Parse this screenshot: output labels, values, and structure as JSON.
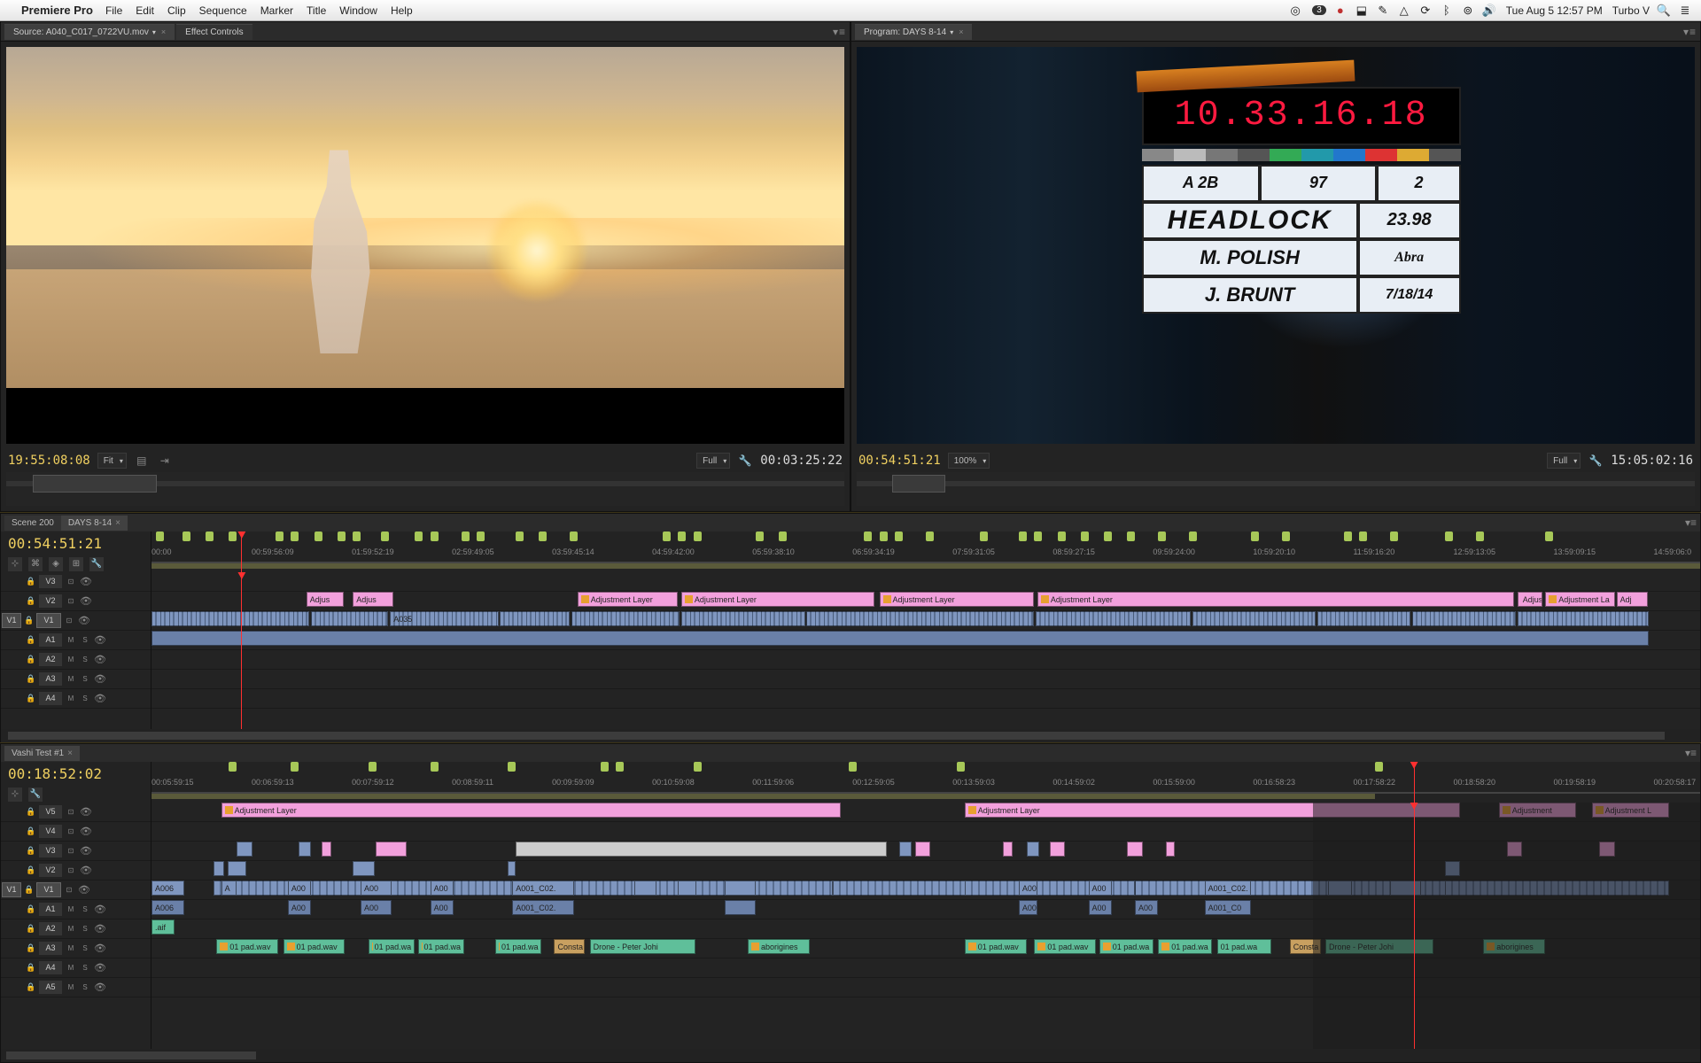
{
  "menubar": {
    "app": "Premiere Pro",
    "items": [
      "File",
      "Edit",
      "Clip",
      "Sequence",
      "Marker",
      "Title",
      "Window",
      "Help"
    ],
    "clock": "Tue Aug 5  12:57 PM",
    "user": "Turbo V",
    "badge": "3"
  },
  "source": {
    "tabs": [
      {
        "label": "Source: A040_C017_0722VU.mov",
        "active": true
      },
      {
        "label": "Effect Controls",
        "active": false
      }
    ],
    "tc_in": "19:55:08:08",
    "zoom": "Fit",
    "res": "Full",
    "duration": "00:03:25:22"
  },
  "program": {
    "tabs": [
      {
        "label": "Program: DAYS 8-14",
        "active": true
      }
    ],
    "tc": "00:54:51:21",
    "zoom": "100%",
    "res": "Full",
    "duration": "15:05:02:16",
    "slate": {
      "smpte": "10.33.16.18",
      "scene": "A 2B",
      "take": "97",
      "roll": "2",
      "title": "HEADLOCK",
      "fps": "23.98",
      "dp": "M. POLISH",
      "loc": "Abra",
      "ac": "J. BRUNT",
      "date": "7/18/14"
    }
  },
  "timeline1": {
    "tabs": [
      {
        "label": "Scene 200",
        "active": false
      },
      {
        "label": "DAYS 8-14",
        "active": true
      }
    ],
    "tc": "00:54:51:21",
    "ruler": [
      "00:00",
      "00:59:56:09",
      "01:59:52:19",
      "02:59:49:05",
      "03:59:45:14",
      "04:59:42:00",
      "05:59:38:10",
      "06:59:34:19",
      "07:59:31:05",
      "08:59:27:15",
      "09:59:24:00",
      "10:59:20:10",
      "11:59:16:20",
      "12:59:13:05",
      "13:59:09:15",
      "14:59:06:0"
    ],
    "tracks": [
      "V3",
      "V2",
      "V1",
      "A1",
      "A2",
      "A3",
      "A4"
    ],
    "adj_label": "Adjustment Layer",
    "adj_short": "Adjus",
    "a035": "A035"
  },
  "timeline2": {
    "tabs": [
      {
        "label": "Vashi Test #1",
        "active": true
      }
    ],
    "tc": "00:18:52:02",
    "ruler": [
      "00:05:59:15",
      "00:06:59:13",
      "00:07:59:12",
      "00:08:59:11",
      "00:09:59:09",
      "00:10:59:08",
      "00:11:59:06",
      "00:12:59:05",
      "00:13:59:03",
      "00:14:59:02",
      "00:15:59:00",
      "00:16:58:23",
      "00:17:58:22",
      "00:18:58:20",
      "00:19:58:19",
      "00:20:58:17"
    ],
    "tracks": [
      "V5",
      "V4",
      "V3",
      "V2",
      "V1",
      "A1",
      "A2",
      "A3",
      "A4",
      "A5"
    ],
    "adj_label": "Adjustment Layer",
    "clips": {
      "a006": "A006",
      "a001": "A001_C02.",
      "a00": "A00",
      "a": "A",
      "aif": ".aif",
      "pad": "01 pad.wav",
      "pad_s": "01 pad.wa",
      "const": "Consta",
      "drone": "Drone - Peter Johi",
      "abor": "aborigines"
    }
  }
}
